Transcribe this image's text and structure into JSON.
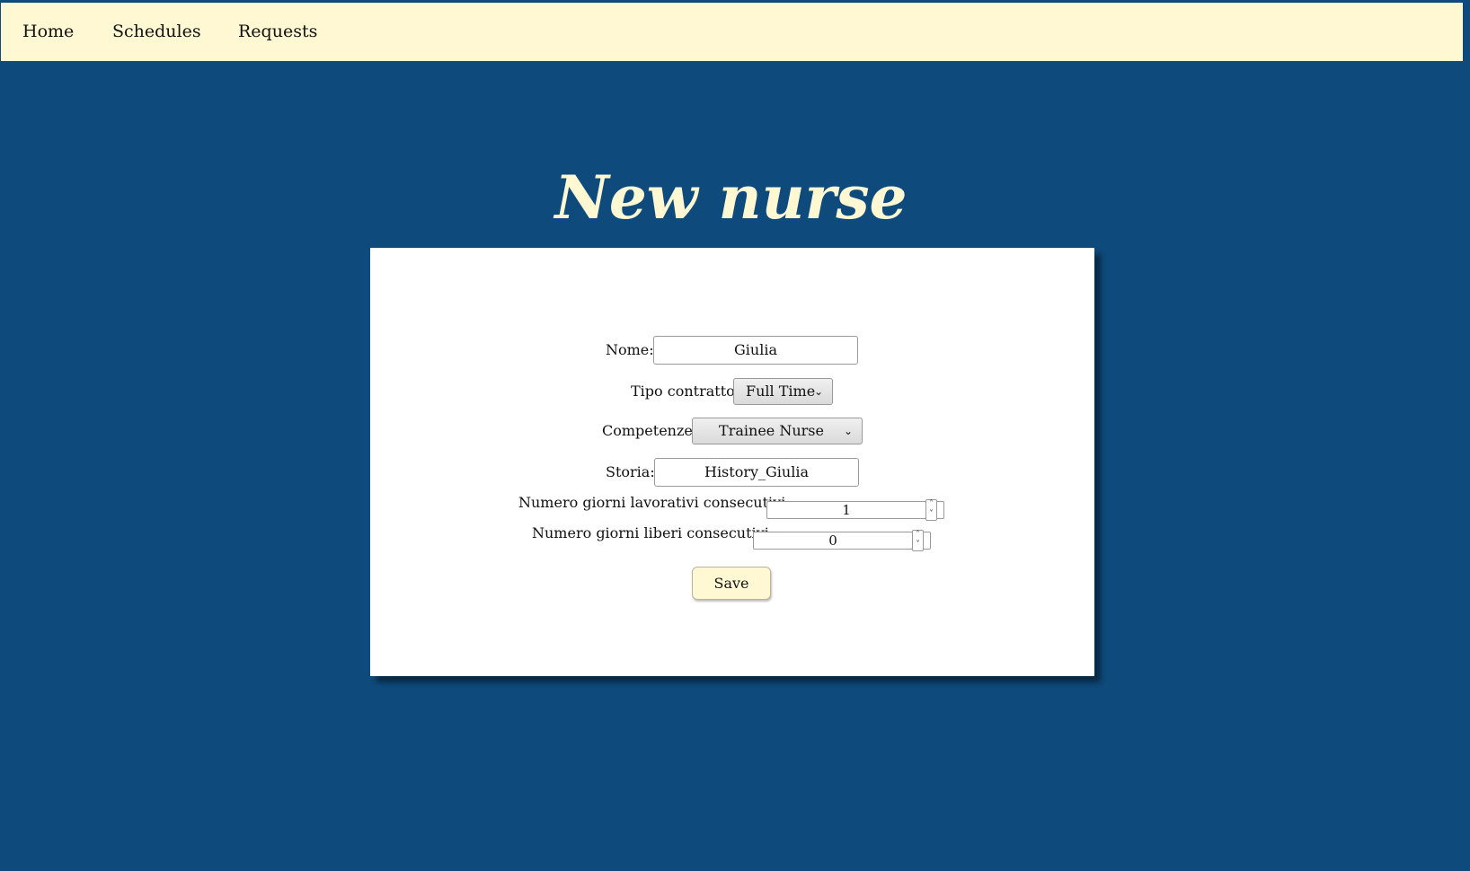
{
  "nav": {
    "items": [
      {
        "label": "Home"
      },
      {
        "label": "Schedules"
      },
      {
        "label": "Requests"
      }
    ]
  },
  "page": {
    "title": "New nurse"
  },
  "form": {
    "nome_label": "Nome:",
    "nome_value": "Giulia",
    "tipo_contratto_label": "Tipo contratto:",
    "tipo_contratto_value": "Full Time",
    "competenze_label": "Competenze:",
    "competenze_value": "Trainee Nurse",
    "storia_label": "Storia:",
    "storia_value": "History_Giulia",
    "giorni_lavorativi_label": "Numero giorni lavorativi consecutivi:",
    "giorni_lavorativi_value": "1",
    "giorni_liberi_label": "Numero giorni liberi consecutivi:",
    "giorni_liberi_value": "0",
    "save_label": "Save"
  },
  "colors": {
    "background": "#0e4a7c",
    "nav_background": "#fff8d2",
    "title": "#fff8d2",
    "card": "#ffffff",
    "button": "#fff8d2"
  },
  "icons": {
    "select_chevron": "chevron-down-icon",
    "spin_up": "chevron-up-icon",
    "spin_down": "chevron-down-icon"
  }
}
